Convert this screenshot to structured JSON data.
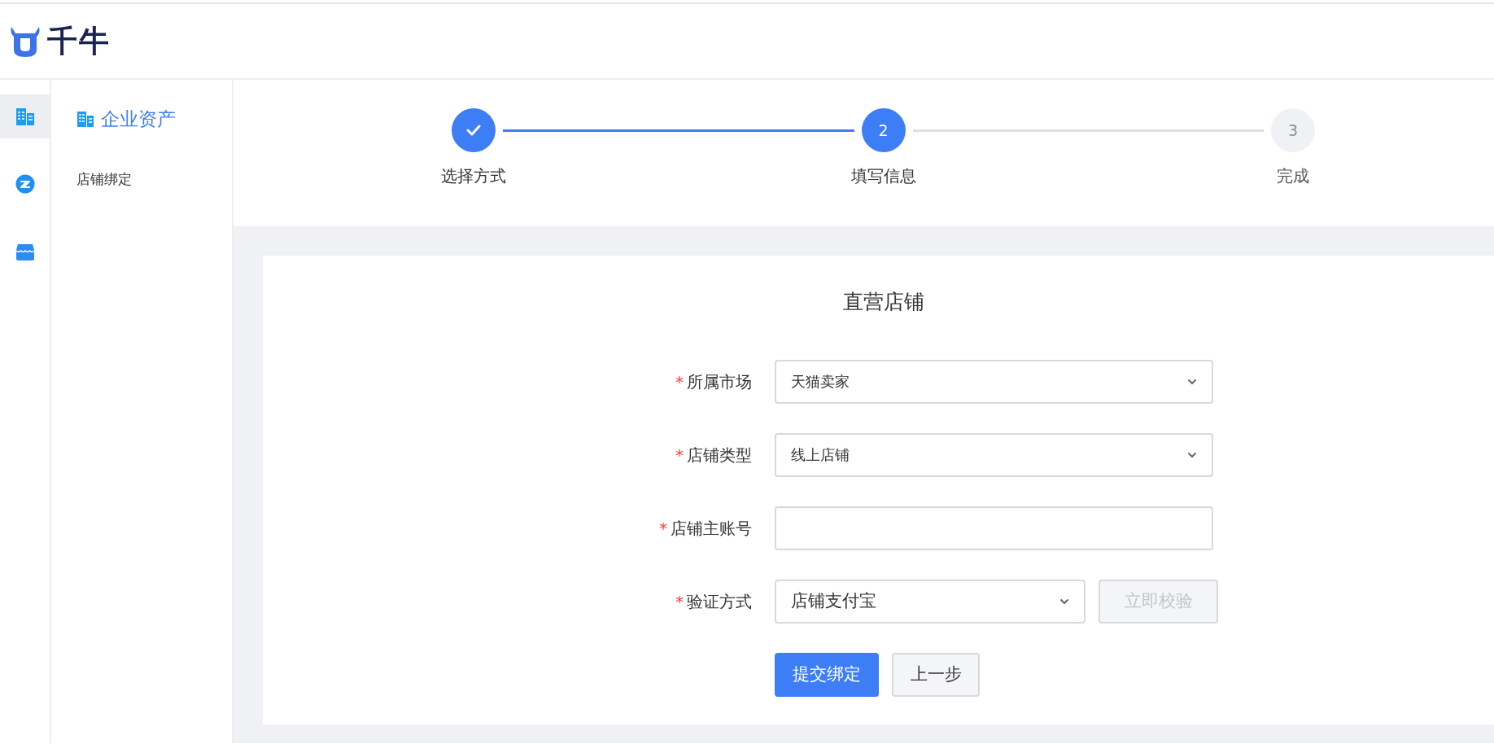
{
  "header": {
    "logo_text": "千牛"
  },
  "rail": [
    {
      "kind": "building",
      "selected": true
    },
    {
      "kind": "z-circle",
      "selected": false
    },
    {
      "kind": "store",
      "selected": false
    }
  ],
  "sidebar": {
    "title": "企业资产",
    "items": [
      {
        "label": "店铺绑定",
        "selected": false
      }
    ]
  },
  "steps": [
    {
      "label": "选择方式",
      "completed": true,
      "current": false
    },
    {
      "label": "填写信息",
      "number": "2",
      "completed": false,
      "current": true
    },
    {
      "label": "完成",
      "number": "3",
      "completed": false,
      "current": false
    }
  ],
  "form": {
    "title": "直营店铺",
    "fields": [
      {
        "kind": "select",
        "required_mark": "*",
        "label": "所属市场",
        "value": "天猫卖家"
      },
      {
        "kind": "select",
        "required_mark": "*",
        "label": "店铺类型",
        "value": "线上店铺"
      },
      {
        "kind": "input",
        "required_mark": "*",
        "label": "店铺主账号"
      },
      {
        "kind": "select-action",
        "required_mark": "*",
        "label": "验证方式",
        "value": "店铺支付宝",
        "action": {
          "label": "立即校验",
          "disabled": true
        }
      }
    ],
    "buttons": [
      {
        "label": "提交绑定",
        "kind": "primary"
      },
      {
        "label": "上一步",
        "kind": "secondary"
      }
    ]
  }
}
